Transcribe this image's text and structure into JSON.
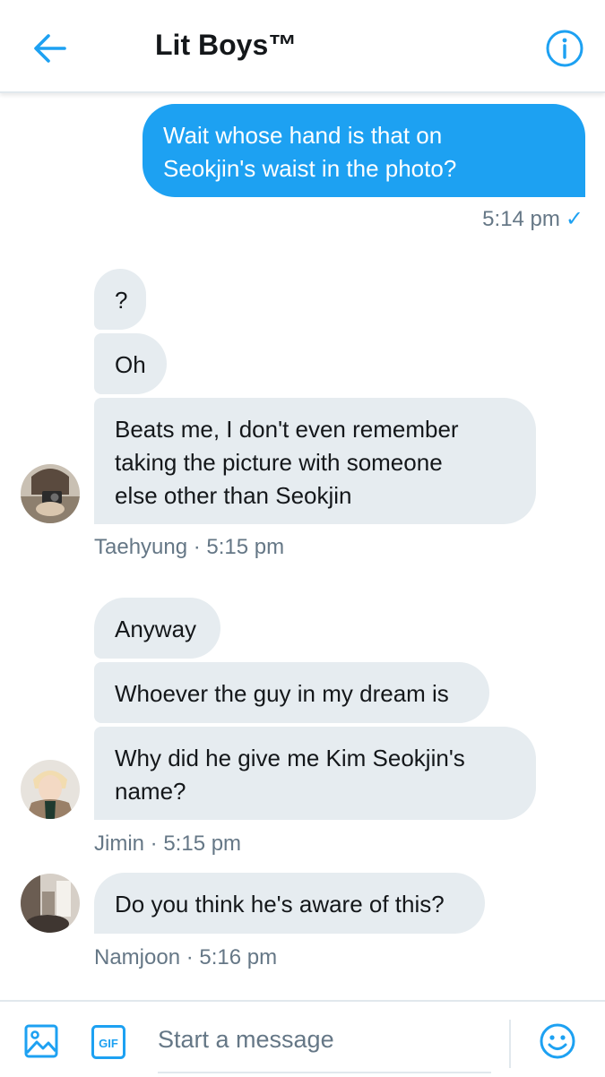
{
  "header": {
    "title": "Lit Boys™",
    "back_icon": "arrow-left-icon",
    "info_icon": "info-icon"
  },
  "colors": {
    "accent": "#1da1f2",
    "incoming_bubble": "#e6ecf0",
    "meta_text": "#657786"
  },
  "messages": {
    "outgoing": {
      "text": "Wait whose hand is that on\nSeokjin's waist in the photo?",
      "time": "5:14 pm",
      "read_mark": "✓"
    },
    "taehyung": {
      "bubbles": [
        "?",
        "Oh",
        "Beats me, I don't even remember\ntaking the picture with someone\nelse other than Seokjin"
      ],
      "sender": "Taehyung",
      "time": "5:15 pm",
      "meta": "Taehyung · 5:15 pm"
    },
    "jimin": {
      "bubbles": [
        "Anyway",
        "Whoever the guy in my dream is",
        "Why did he give me Kim Seokjin's\nname?"
      ],
      "sender": "Jimin",
      "time": "5:15 pm",
      "meta": "Jimin · 5:15 pm"
    },
    "namjoon": {
      "bubbles": [
        "Do you think he's aware of this?"
      ],
      "sender": "Namjoon",
      "time": "5:16 pm",
      "meta": "Namjoon · 5:16 pm"
    }
  },
  "composer": {
    "placeholder": "Start a message",
    "image_icon": "image-icon",
    "gif_icon": "gif-icon",
    "gif_label": "GIF",
    "emoji_icon": "emoji-icon"
  }
}
